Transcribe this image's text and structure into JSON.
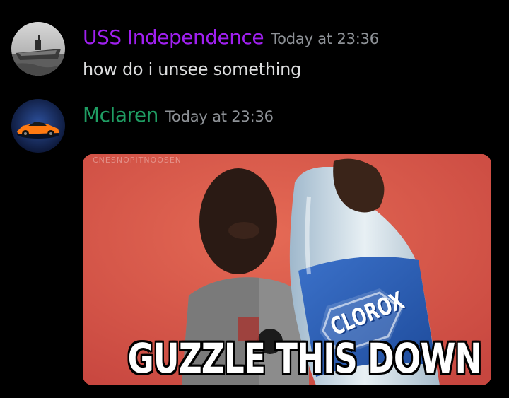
{
  "messages": [
    {
      "username": "USS Independence",
      "username_color": "#a020f0",
      "timestamp": "Today at 23:36",
      "text": "how do i unsee something",
      "avatar_icon": "aircraft-carrier-avatar"
    },
    {
      "username": "Mclaren",
      "username_color": "#1f9d63",
      "timestamp": "Today at 23:36",
      "avatar_icon": "orange-sports-car-avatar",
      "attachment": {
        "type": "gif",
        "caption": "GUZZLE THIS DOWN",
        "bottle_brand": "CLOROX",
        "watermark": "CNESNOPITNOOSEN"
      }
    }
  ],
  "colors": {
    "background": "#000000",
    "timestamp": "#8e9297",
    "message_text": "#dcddde"
  }
}
